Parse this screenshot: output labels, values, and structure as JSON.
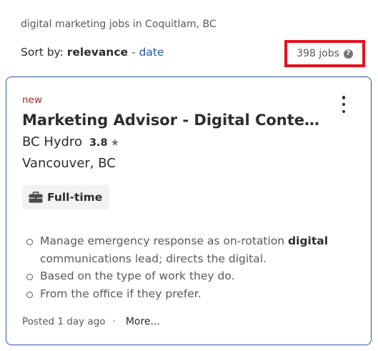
{
  "search": {
    "summary": "digital marketing jobs in Coquitlam, BC"
  },
  "sort": {
    "prefix": "Sort by:",
    "active": "relevance",
    "separator": "-",
    "alt": "date"
  },
  "results": {
    "count_label": "398 jobs",
    "help_glyph": "?"
  },
  "job": {
    "badge": "new",
    "title": "Marketing Advisor - Digital Content Specialist",
    "company": "BC Hydro",
    "rating": "3.8",
    "rating_icon": "star-icon",
    "location": "Vancouver, BC",
    "job_type": "Full-time",
    "job_type_icon": "briefcase-icon",
    "snippet": {
      "item1_pre": "Manage emergency response as on-rotation",
      "item1_bold": "digital",
      "item1_post": "communications lead; directs the digital.",
      "item2": "Based on the type of work they do.",
      "item3": "From the office if they prefer."
    },
    "posted": "Posted 1 day ago",
    "separator": "·",
    "more_label": "More..."
  },
  "colors": {
    "accent": "#2557a7",
    "highlight_box": "#e8101c",
    "new_badge": "#a9252b"
  }
}
